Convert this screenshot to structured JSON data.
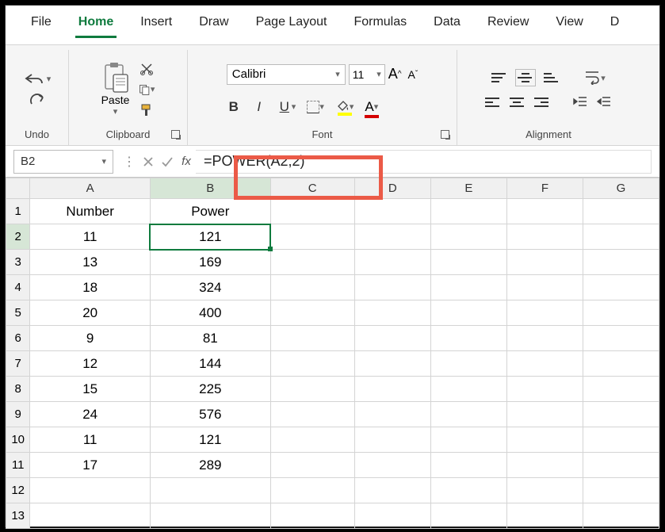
{
  "menu": {
    "file": "File",
    "home": "Home",
    "insert": "Insert",
    "draw": "Draw",
    "pagelayout": "Page Layout",
    "formulas": "Formulas",
    "data": "Data",
    "review": "Review",
    "view": "View",
    "extra": "D"
  },
  "ribbon": {
    "undo_label": "Undo",
    "clipboard_label": "Clipboard",
    "paste_label": "Paste",
    "font_label": "Font",
    "font_name": "Calibri",
    "font_size": "11",
    "bold": "B",
    "italic": "I",
    "underline": "U",
    "increase_font": "A",
    "decrease_font": "A",
    "font_color_letter": "A",
    "alignment_label": "Alignment"
  },
  "formula_bar": {
    "name_box": "B2",
    "fx": "fx",
    "formula": "=POWER(A2,2)"
  },
  "columns": [
    "A",
    "B",
    "C",
    "D",
    "E",
    "F",
    "G"
  ],
  "headers": {
    "A": "Number",
    "B": "Power"
  },
  "rows": [
    {
      "n": "1",
      "A": "Number",
      "B": "Power"
    },
    {
      "n": "2",
      "A": "11",
      "B": "121"
    },
    {
      "n": "3",
      "A": "13",
      "B": "169"
    },
    {
      "n": "4",
      "A": "18",
      "B": "324"
    },
    {
      "n": "5",
      "A": "20",
      "B": "400"
    },
    {
      "n": "6",
      "A": "9",
      "B": "81"
    },
    {
      "n": "7",
      "A": "12",
      "B": "144"
    },
    {
      "n": "8",
      "A": "15",
      "B": "225"
    },
    {
      "n": "9",
      "A": "24",
      "B": "576"
    },
    {
      "n": "10",
      "A": "11",
      "B": "121"
    },
    {
      "n": "11",
      "A": "17",
      "B": "289"
    },
    {
      "n": "12",
      "A": "",
      "B": ""
    },
    {
      "n": "13",
      "A": "",
      "B": ""
    }
  ],
  "selected_cell": "B2",
  "chart_data": {
    "type": "table",
    "title": "POWER function squares",
    "columns": [
      "Number",
      "Power"
    ],
    "rows": [
      [
        11,
        121
      ],
      [
        13,
        169
      ],
      [
        18,
        324
      ],
      [
        20,
        400
      ],
      [
        9,
        81
      ],
      [
        12,
        144
      ],
      [
        15,
        225
      ],
      [
        24,
        576
      ],
      [
        11,
        121
      ],
      [
        17,
        289
      ]
    ]
  }
}
